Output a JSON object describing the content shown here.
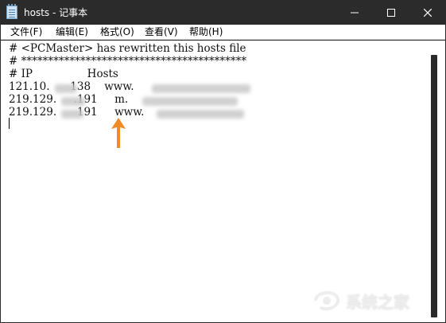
{
  "window": {
    "title": "hosts - 记事本",
    "controls": {
      "minimize": "—",
      "maximize": "□",
      "close": "✕"
    }
  },
  "menu": {
    "items": [
      {
        "label": "文件(F)"
      },
      {
        "label": "编辑(E)"
      },
      {
        "label": "格式(O)"
      },
      {
        "label": "查看(V)"
      },
      {
        "label": "帮助(H)"
      }
    ]
  },
  "editor": {
    "lines": [
      "# <PCMaster> has rewritten this hosts file",
      "# ******************************************",
      "# IP                Hosts",
      "121.10.      138    www.",
      "219.129.     .191     m.",
      "219.129.      191     www."
    ]
  },
  "annotation": {
    "arrow_color": "#f08a24"
  },
  "watermark": {
    "text": "系统之家"
  },
  "colors": {
    "titlebar": "#2b2b2b",
    "editor_bg": "#ffffff",
    "text": "#111111"
  }
}
